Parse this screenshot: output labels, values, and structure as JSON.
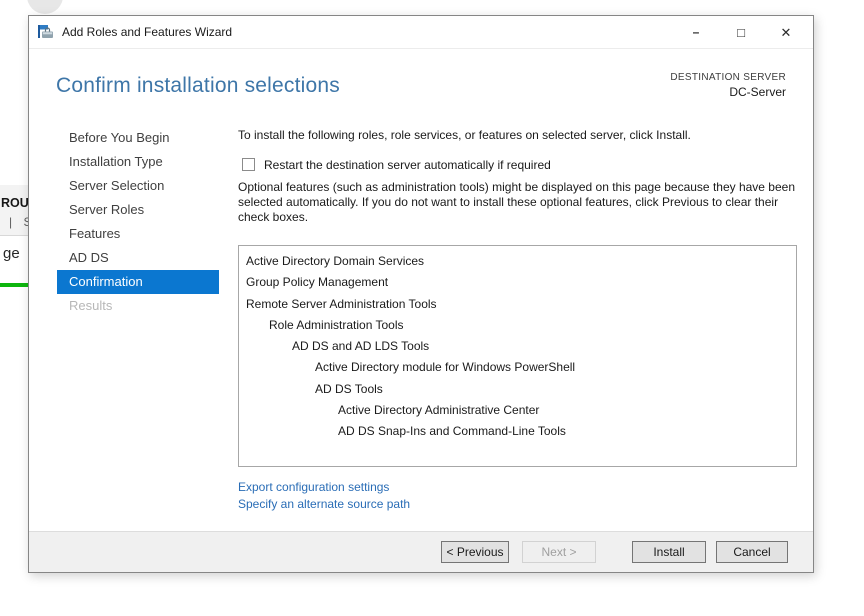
{
  "window": {
    "title": "Add Roles and Features Wizard",
    "controls": {
      "minimize": "–",
      "maximize": "□",
      "close": "✕"
    }
  },
  "header": {
    "title": "Confirm installation selections",
    "destination_label": "DESTINATION SERVER",
    "destination_server": "DC-Server"
  },
  "sidebar": {
    "items": [
      {
        "label": "Before You Begin",
        "state": ""
      },
      {
        "label": "Installation Type",
        "state": ""
      },
      {
        "label": "Server Selection",
        "state": ""
      },
      {
        "label": "Server Roles",
        "state": ""
      },
      {
        "label": "Features",
        "state": ""
      },
      {
        "label": "AD DS",
        "state": ""
      },
      {
        "label": "Confirmation",
        "state": "selected"
      },
      {
        "label": "Results",
        "state": "disabled"
      }
    ]
  },
  "main": {
    "intro": "To install the following roles, role services, or features on selected server, click Install.",
    "restart_checkbox": {
      "checked": false,
      "label": "Restart the destination server automatically if required"
    },
    "optional_note": "Optional features (such as administration tools) might be displayed on this page because they have been selected automatically. If you do not want to install these optional features, click Previous to clear their check boxes.",
    "selection_list": [
      {
        "label": "Active Directory Domain Services",
        "indent": 0
      },
      {
        "label": "Group Policy Management",
        "indent": 0
      },
      {
        "label": "Remote Server Administration Tools",
        "indent": 0
      },
      {
        "label": "Role Administration Tools",
        "indent": 1
      },
      {
        "label": "AD DS and AD LDS Tools",
        "indent": 2
      },
      {
        "label": "Active Directory module for Windows PowerShell",
        "indent": 3
      },
      {
        "label": "AD DS Tools",
        "indent": 3
      },
      {
        "label": "Active Directory Administrative Center",
        "indent": 4
      },
      {
        "label": "AD DS Snap-Ins and Command-Line Tools",
        "indent": 4
      }
    ],
    "links": [
      "Export configuration settings",
      "Specify an alternate source path"
    ]
  },
  "footer": {
    "buttons": [
      {
        "label": "< Previous",
        "key": "previous",
        "enabled": true
      },
      {
        "label": "Next >",
        "key": "next",
        "enabled": false
      },
      {
        "label": "Install",
        "key": "install",
        "enabled": true
      },
      {
        "label": "Cancel",
        "key": "cancel",
        "enabled": true
      }
    ]
  },
  "background": {
    "fragments": {
      "rou": "ROU",
      "pipe_s": "| S",
      "ge": "ge"
    }
  },
  "colors": {
    "select-blue": "#0b77d0",
    "title-blue": "#3e76a8",
    "link-blue": "#2a6db6",
    "green": "#0db50d"
  }
}
